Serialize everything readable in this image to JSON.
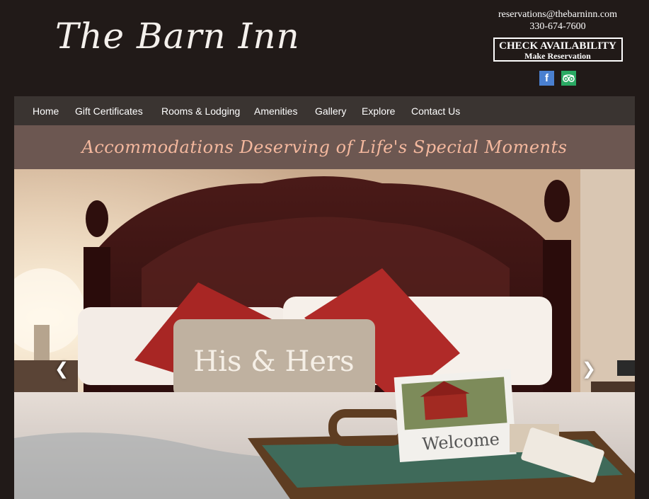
{
  "brand": {
    "logo_text": "The Barn Inn"
  },
  "contact": {
    "email": "reservations@thebarninn.com",
    "phone": "330-674-7600",
    "check_line1": "CHECK AVAILABILITY",
    "check_line2": "Make Reservation"
  },
  "social": {
    "facebook_glyph": "f"
  },
  "nav": {
    "items": [
      "Home",
      "Gift Certificates",
      "Rooms & Lodging",
      "Amenities",
      "Gallery",
      "Explore",
      "Contact Us"
    ]
  },
  "tagline": "Accommodations Deserving of Life's Special Moments",
  "hero": {
    "pillow_text": "His & Hers",
    "card_text": "Welcome",
    "prev_glyph": "❮",
    "next_glyph": "❯"
  },
  "colors": {
    "page_bg": "#211a18",
    "nav_bg": "#3a3431",
    "tagline_bg": "#6c5751",
    "tagline_text": "#f4b89e",
    "facebook": "#4a80d0",
    "tripadvisor": "#2aaa63"
  }
}
